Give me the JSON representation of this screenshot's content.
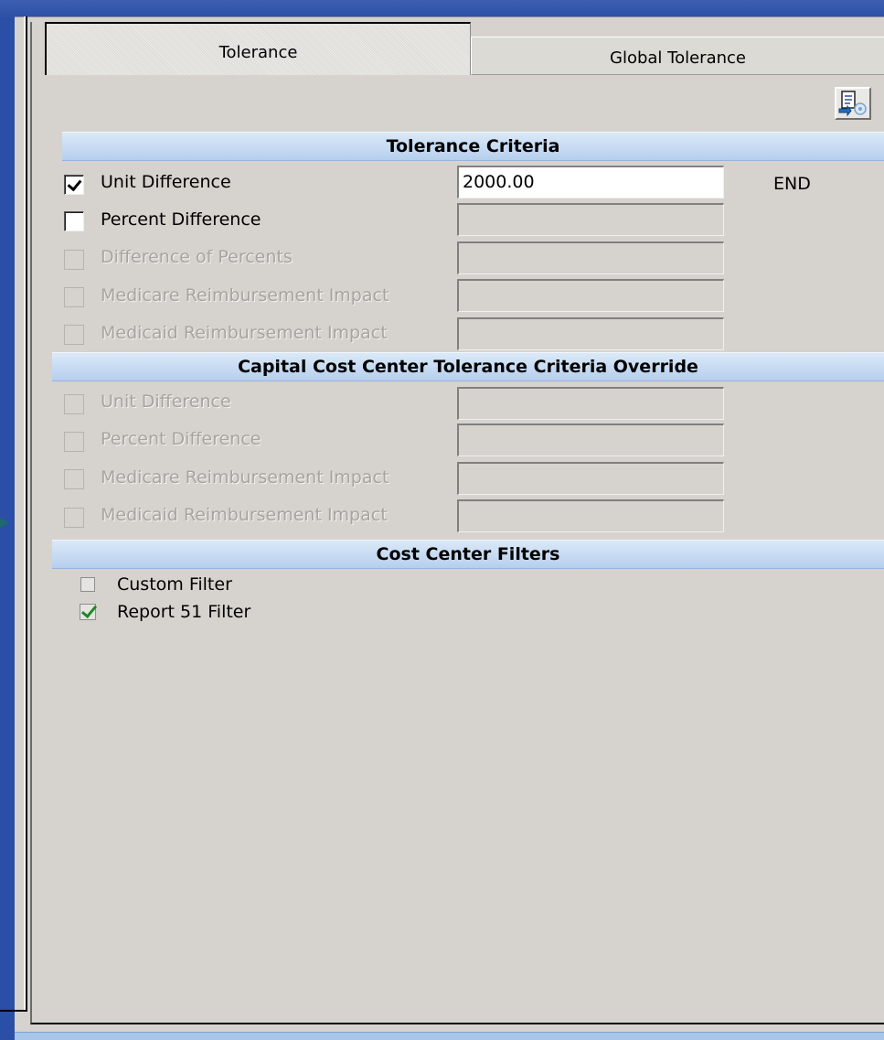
{
  "tabs": [
    {
      "label": "Tolerance",
      "selected": true
    },
    {
      "label": "Global Tolerance",
      "selected": false
    }
  ],
  "toolbar": {
    "icon": "document-settings-icon"
  },
  "tolerance_criteria": {
    "title": "Tolerance Criteria",
    "rows": [
      {
        "label": "Unit Difference",
        "checked": true,
        "enabled": true,
        "value": "2000.00",
        "field_enabled": true
      },
      {
        "label": "Percent Difference",
        "checked": false,
        "enabled": true,
        "value": "",
        "field_enabled": false
      },
      {
        "label": "Difference of Percents",
        "checked": false,
        "enabled": false,
        "value": "",
        "field_enabled": false
      },
      {
        "label": "Medicare Reimbursement Impact",
        "checked": false,
        "enabled": false,
        "value": "",
        "field_enabled": false
      },
      {
        "label": "Medicaid Reimbursement Impact",
        "checked": false,
        "enabled": false,
        "value": "",
        "field_enabled": false
      }
    ],
    "end_label": "END"
  },
  "capital_override": {
    "title": "Capital Cost Center Tolerance Criteria Override",
    "rows": [
      {
        "label": "Unit Difference",
        "checked": false,
        "enabled": false,
        "value": ""
      },
      {
        "label": "Percent Difference",
        "checked": false,
        "enabled": false,
        "value": ""
      },
      {
        "label": "Medicare Reimbursement Impact",
        "checked": false,
        "enabled": false,
        "value": ""
      },
      {
        "label": "Medicaid Reimbursement Impact",
        "checked": false,
        "enabled": false,
        "value": ""
      }
    ]
  },
  "filters": {
    "title": "Cost Center Filters",
    "items": [
      {
        "label": "Custom Filter",
        "checked": false
      },
      {
        "label": "Report 51 Filter",
        "checked": true
      }
    ]
  },
  "colors": {
    "background_blue": "#2b4fa6",
    "panel_gray": "#d6d3ce",
    "header_blue": "#b6cfee",
    "check_green": "#1b8a2a"
  }
}
